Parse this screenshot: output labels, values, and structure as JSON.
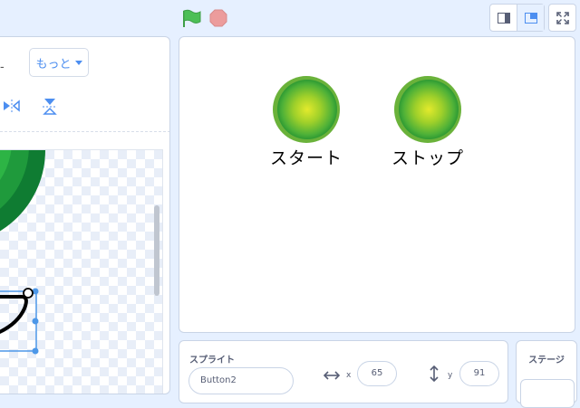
{
  "editor": {
    "dash": "-",
    "more_label": "もっと"
  },
  "stage": {
    "sprites": [
      {
        "label": "スタート"
      },
      {
        "label": "ストップ"
      }
    ]
  },
  "sprite_info": {
    "title": "スプライト",
    "name": "Button2",
    "x_label": "x",
    "x_value": "65",
    "y_label": "y",
    "y_value": "91"
  },
  "stage_panel": {
    "title": "ステージ"
  },
  "colors": {
    "accent": "#4c8ef0",
    "flag": "#4cbf56",
    "stop": "#ec9c9c",
    "button_outer": "#76b83a",
    "button_inner": "#d7e62a"
  }
}
